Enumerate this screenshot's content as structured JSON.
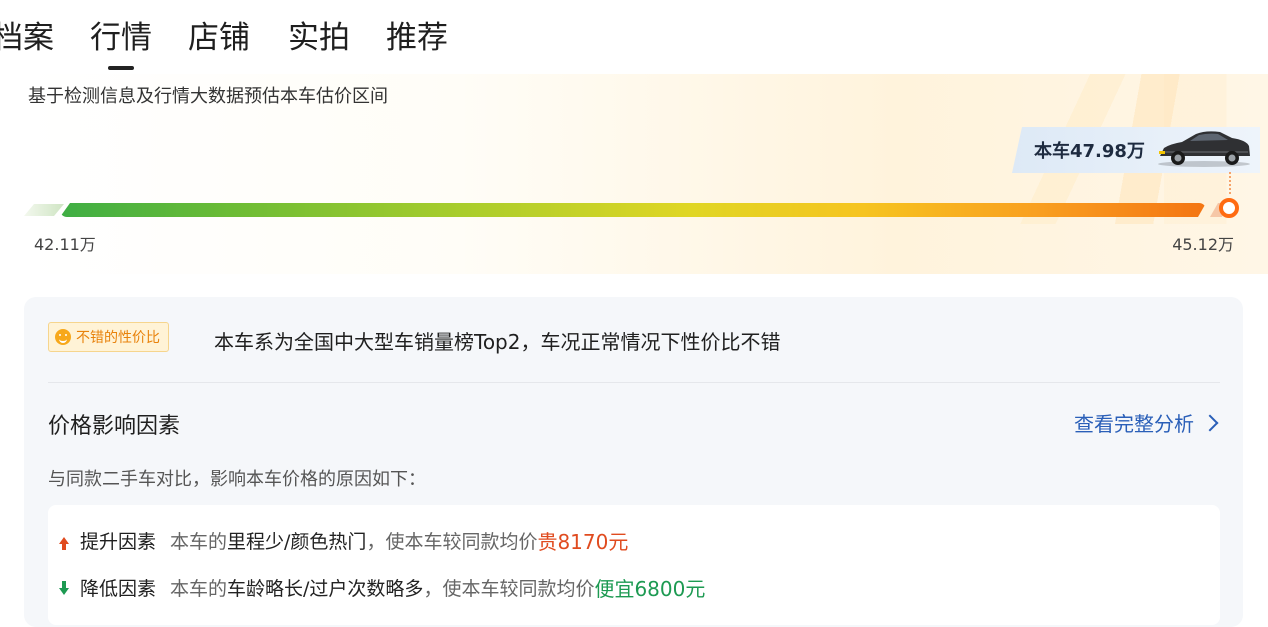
{
  "tabs": [
    {
      "label": "档案",
      "active": false
    },
    {
      "label": "行情",
      "active": true
    },
    {
      "label": "店铺",
      "active": false
    },
    {
      "label": "实拍",
      "active": false
    },
    {
      "label": "推荐",
      "active": false
    }
  ],
  "hero": {
    "subtitle": "基于检测信息及行情大数据预估本车估价区间",
    "car_price_label": "本车47.98万",
    "range_min": "42.11万",
    "range_max": "45.12万"
  },
  "evaluation": {
    "badge": "不错的性价比",
    "badge_icon": "smile-icon",
    "text": "本车系为全国中大型车销量榜Top2，车况正常情况下性价比不错"
  },
  "factors": {
    "title": "价格影响因素",
    "link_label": "查看完整分析",
    "subtitle": "与同款二手车对比，影响本车价格的原因如下：",
    "rows": [
      {
        "kind": "提升因素",
        "prefix": "本车的",
        "detail": "里程少/颜色热门",
        "mid": "，使本车较同款均价",
        "result": "贵8170元",
        "direction": "up"
      },
      {
        "kind": "降低因素",
        "prefix": "本车的",
        "detail": "车龄略长/过户次数略多",
        "mid": "，使本车较同款均价",
        "result": "便宜6800元",
        "direction": "down"
      }
    ]
  },
  "colors": {
    "up": "#e04b1f",
    "down": "#1d9a52",
    "link": "#2a5fb8",
    "accent": "#ff6b12"
  }
}
